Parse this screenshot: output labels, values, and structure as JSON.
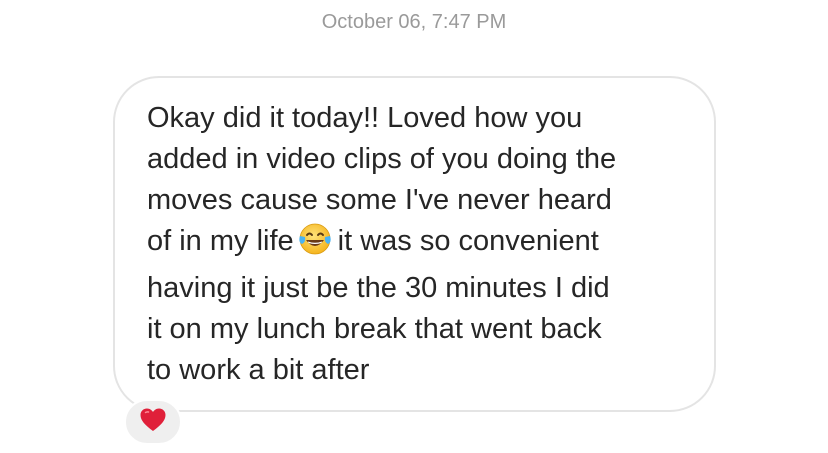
{
  "thread": {
    "timestamp": "October 06, 7:47 PM"
  },
  "message": {
    "lines": [
      "Okay did it today!! Loved how you",
      "added in video clips of you doing the",
      "moves cause some I've never heard",
      "of in my life",
      "it was so convenient",
      "having it just be the 30 minutes I did",
      "it on my lunch break that went back",
      "to work a bit after"
    ],
    "inline_emoji": "face-with-tears-of-joy-icon"
  },
  "reaction": {
    "emoji": "red-heart-icon"
  },
  "colors": {
    "text": "#262626",
    "timestamp": "#9a9a9a",
    "bubble_border": "#e4e4e4",
    "reaction_bg": "#efefef",
    "heart": "#e0203a"
  }
}
